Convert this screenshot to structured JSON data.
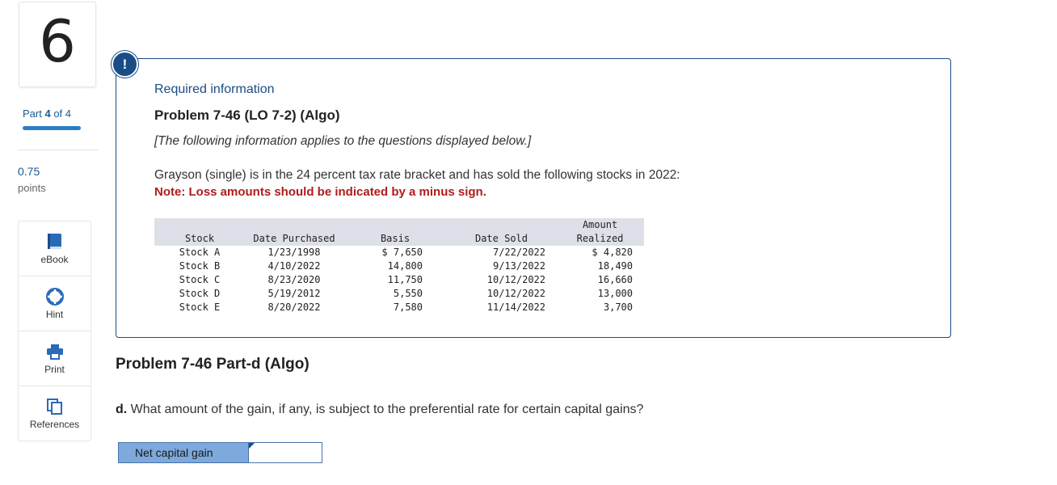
{
  "question_number": "6",
  "progress": {
    "part_label": "Part",
    "part_current": "4",
    "of_text": "of 4",
    "fraction_complete": 1.0
  },
  "points": {
    "value": "0.75",
    "label": "points"
  },
  "tools": [
    {
      "icon": "book-icon",
      "label": "eBook"
    },
    {
      "icon": "lifebuoy-icon",
      "label": "Hint"
    },
    {
      "icon": "printer-icon",
      "label": "Print"
    },
    {
      "icon": "copy-icon",
      "label": "References"
    }
  ],
  "info": {
    "badge": "!",
    "heading": "Required information",
    "problem_title": "Problem 7-46 (LO 7-2) (Algo)",
    "italic_text": "[The following information applies to the questions displayed below.]",
    "description": "Grayson (single) is in the 24 percent tax rate bracket and has sold the following stocks in 2022:",
    "note": "Note: Loss amounts should be indicated by a minus sign."
  },
  "table": {
    "headers": [
      "Stock",
      "Date Purchased",
      "Basis",
      "Date Sold",
      "Amount"
    ],
    "header_line2": "Realized",
    "rows": [
      [
        "Stock A",
        "1/23/1998",
        "$ 7,650",
        "7/22/2022",
        "$ 4,820"
      ],
      [
        "Stock B",
        "4/10/2022",
        "14,800",
        "9/13/2022",
        "18,490"
      ],
      [
        "Stock C",
        "8/23/2020",
        "11,750",
        "10/12/2022",
        "16,660"
      ],
      [
        "Stock D",
        "5/19/2012",
        "5,550",
        "10/12/2022",
        "13,000"
      ],
      [
        "Stock E",
        "8/20/2022",
        "7,580",
        "11/14/2022",
        "3,700"
      ]
    ]
  },
  "part_title": "Problem 7-46 Part-d (Algo)",
  "question": {
    "letter": "d.",
    "text": "What amount of the gain, if any, is subject to the preferential rate for certain capital gains?"
  },
  "answer": {
    "label": "Net capital gain",
    "value": ""
  },
  "colors": {
    "accent": "#1a4d86",
    "note_red": "#b01c1c",
    "answer_label_bg": "#7da9dc"
  }
}
